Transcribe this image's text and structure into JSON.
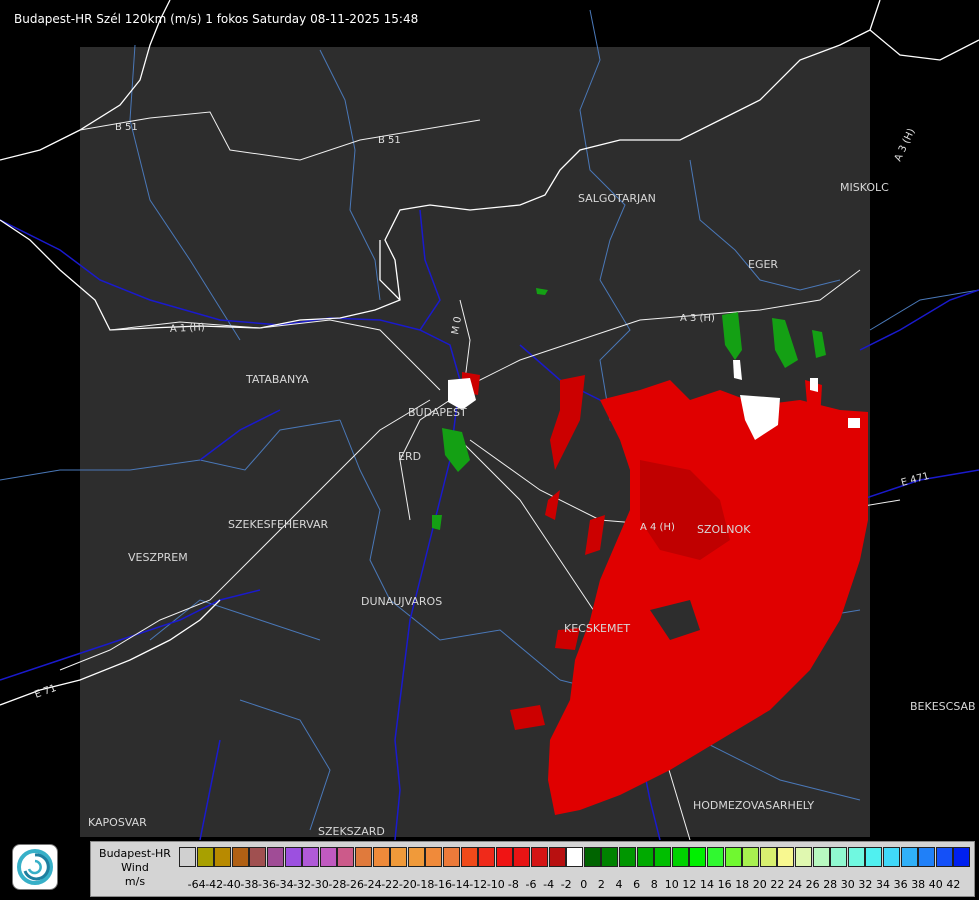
{
  "header": {
    "title": "Budapest-HR Szél 120km (m/s) 1 fokos Saturday 08-11-2025 15:48"
  },
  "map": {
    "cities": [
      {
        "id": "salgotarjan",
        "label": "SALGOTARJAN"
      },
      {
        "id": "miskolc",
        "label": "MISKOLC"
      },
      {
        "id": "eger",
        "label": "EGER"
      },
      {
        "id": "tatabanya",
        "label": "TATABANYA"
      },
      {
        "id": "budapest",
        "label": "BUDAPEST"
      },
      {
        "id": "erd",
        "label": "ERD"
      },
      {
        "id": "szekesfehervar",
        "label": "SZEKESFEHERVAR"
      },
      {
        "id": "veszprem",
        "label": "VESZPREM"
      },
      {
        "id": "dunaujvaros",
        "label": "DUNAUJVAROS"
      },
      {
        "id": "szolnok",
        "label": "SZOLNOK"
      },
      {
        "id": "kecskemet",
        "label": "KECSKEMET"
      },
      {
        "id": "hodmezovasarhely",
        "label": "HODMEZOVASARHELY"
      },
      {
        "id": "bekescsaba",
        "label": "BEKESCSAB"
      },
      {
        "id": "kaposvar",
        "label": "KAPOSVAR"
      },
      {
        "id": "szekszard",
        "label": "SZEKSZARD"
      }
    ],
    "roads": [
      {
        "id": "b51-west",
        "label": "B 51"
      },
      {
        "id": "b51-east",
        "label": "B 51"
      },
      {
        "id": "a3-east",
        "label": "A 3 (H)"
      },
      {
        "id": "a3-ne",
        "label": "A 3 (H)"
      },
      {
        "id": "a4",
        "label": "A 4 (H)"
      },
      {
        "id": "e471",
        "label": "E 471"
      },
      {
        "id": "m1",
        "label": "A 1 (H)"
      },
      {
        "id": "e71",
        "label": "E 71"
      },
      {
        "id": "m0",
        "label": "M 0"
      }
    ],
    "colors": {
      "background": "#000000",
      "radar_area": "#2d2d2d",
      "borders": "#ffffff",
      "rivers": "#1a1acd",
      "counties": "#4a78b8",
      "echo_red": "#e00000",
      "echo_green": "#14a014"
    }
  },
  "legend": {
    "lines": [
      "Budapest-HR",
      "Wind",
      "m/s"
    ],
    "ticks": [
      "-64",
      "-42",
      "-40",
      "-38",
      "-36",
      "-34",
      "-32",
      "-30",
      "-28",
      "-26",
      "-24",
      "-22",
      "-20",
      "-18",
      "-16",
      "-14",
      "-12",
      "-10",
      "-8",
      "-6",
      "-4",
      "-2",
      "0",
      "2",
      "4",
      "6",
      "8",
      "10",
      "12",
      "14",
      "16",
      "18",
      "20",
      "22",
      "24",
      "26",
      "28",
      "30",
      "32",
      "34",
      "36",
      "38",
      "40",
      "42"
    ],
    "colors": [
      "#d0d0d0",
      "#a8a000",
      "#b88a00",
      "#b06014",
      "#a05050",
      "#a04c96",
      "#9c50e0",
      "#b05ad8",
      "#c05ac0",
      "#cc5a8a",
      "#e07a3c",
      "#ee8a3a",
      "#f09a3a",
      "#f09a3a",
      "#f08a3a",
      "#ec7a3a",
      "#f04a1a",
      "#f02a1a",
      "#f01414",
      "#e81414",
      "#d41414",
      "#b81010",
      "#ffffff",
      "#006400",
      "#008200",
      "#009600",
      "#00aa00",
      "#00be00",
      "#00d200",
      "#00f000",
      "#30f830",
      "#70f830",
      "#a8f050",
      "#d8f070",
      "#f8f890",
      "#e0f8b0",
      "#b8f8c0",
      "#90f8d0",
      "#70f8e0",
      "#50f0f0",
      "#40d8f8",
      "#30b0f8",
      "#2080f8",
      "#1450f8",
      "#0020f0"
    ]
  },
  "logo": {
    "icon": "met-service-swirl-icon"
  }
}
